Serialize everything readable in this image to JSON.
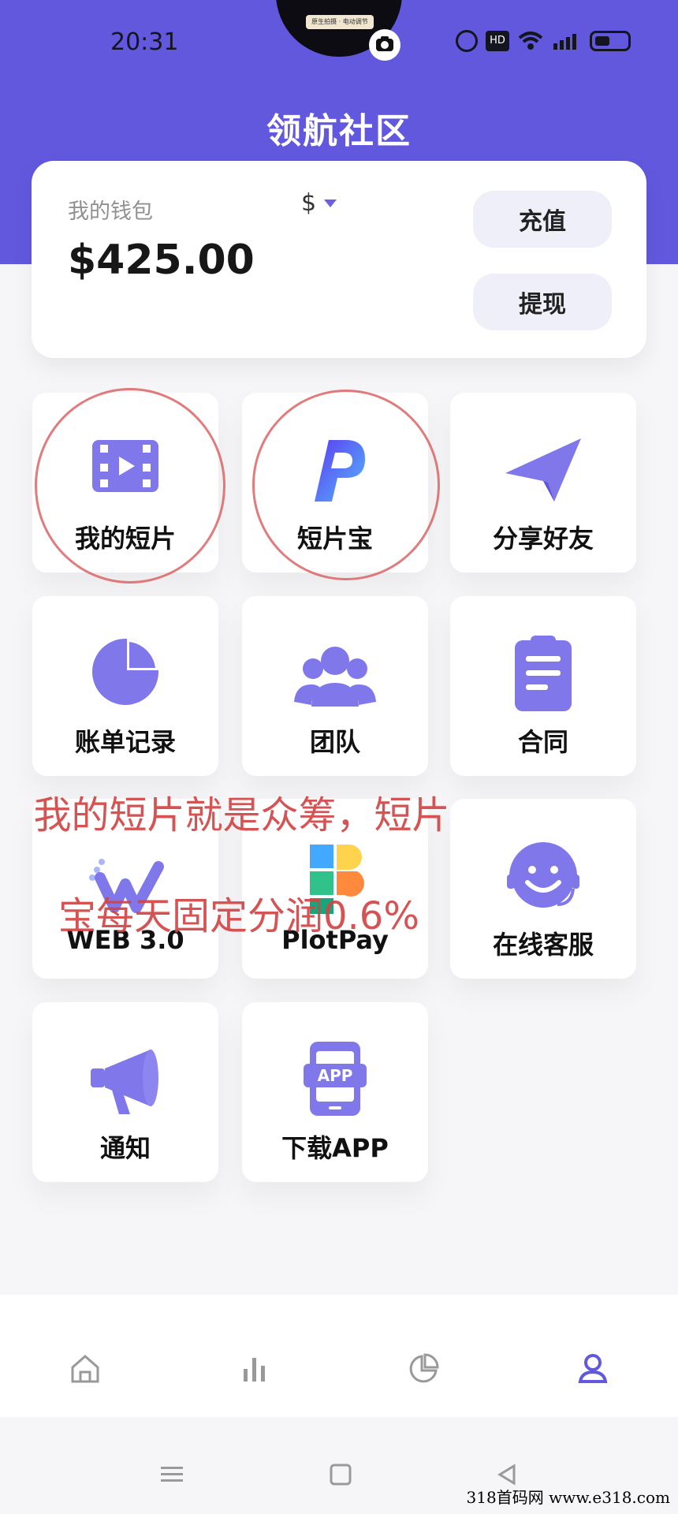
{
  "status_bar": {
    "time": "20:31",
    "hd_badge": "HD",
    "camera_chip_text": "原生拍摄 · 电动调节"
  },
  "page": {
    "title": "领航社区"
  },
  "wallet": {
    "label": "我的钱包",
    "currency": "$",
    "balance": "$425.00",
    "recharge_button": "充值",
    "withdraw_button": "提现"
  },
  "grid": [
    {
      "label": "我的短片",
      "icon": "film-icon"
    },
    {
      "label": "短片宝",
      "icon": "p-logo-icon"
    },
    {
      "label": "分享好友",
      "icon": "paper-plane-icon"
    },
    {
      "label": "账单记录",
      "icon": "pie-chart-icon"
    },
    {
      "label": "团队",
      "icon": "team-icon"
    },
    {
      "label": "合同",
      "icon": "clipboard-icon"
    },
    {
      "label": "WEB 3.0",
      "icon": "web3-icon"
    },
    {
      "label": "PlotPay",
      "icon": "plotpay-icon"
    },
    {
      "label": "在线客服",
      "icon": "customer-service-icon"
    },
    {
      "label": "通知",
      "icon": "megaphone-icon"
    },
    {
      "label": "下载APP",
      "icon": "app-download-icon"
    }
  ],
  "annotation": {
    "line1": "我的短片就是众筹，短片",
    "line2": "宝每天固定分润0.6%"
  },
  "tabbar": [
    "home-icon",
    "bar-chart-icon",
    "pie-chart-icon",
    "profile-icon"
  ],
  "navbar": [
    "menu-icon",
    "home-square-icon",
    "back-icon"
  ],
  "watermark": "318首码网  www.e318.com",
  "colors": {
    "primary": "#6158dd",
    "icon_purple": "#7f77ea",
    "annotation_red": "#d34545"
  }
}
